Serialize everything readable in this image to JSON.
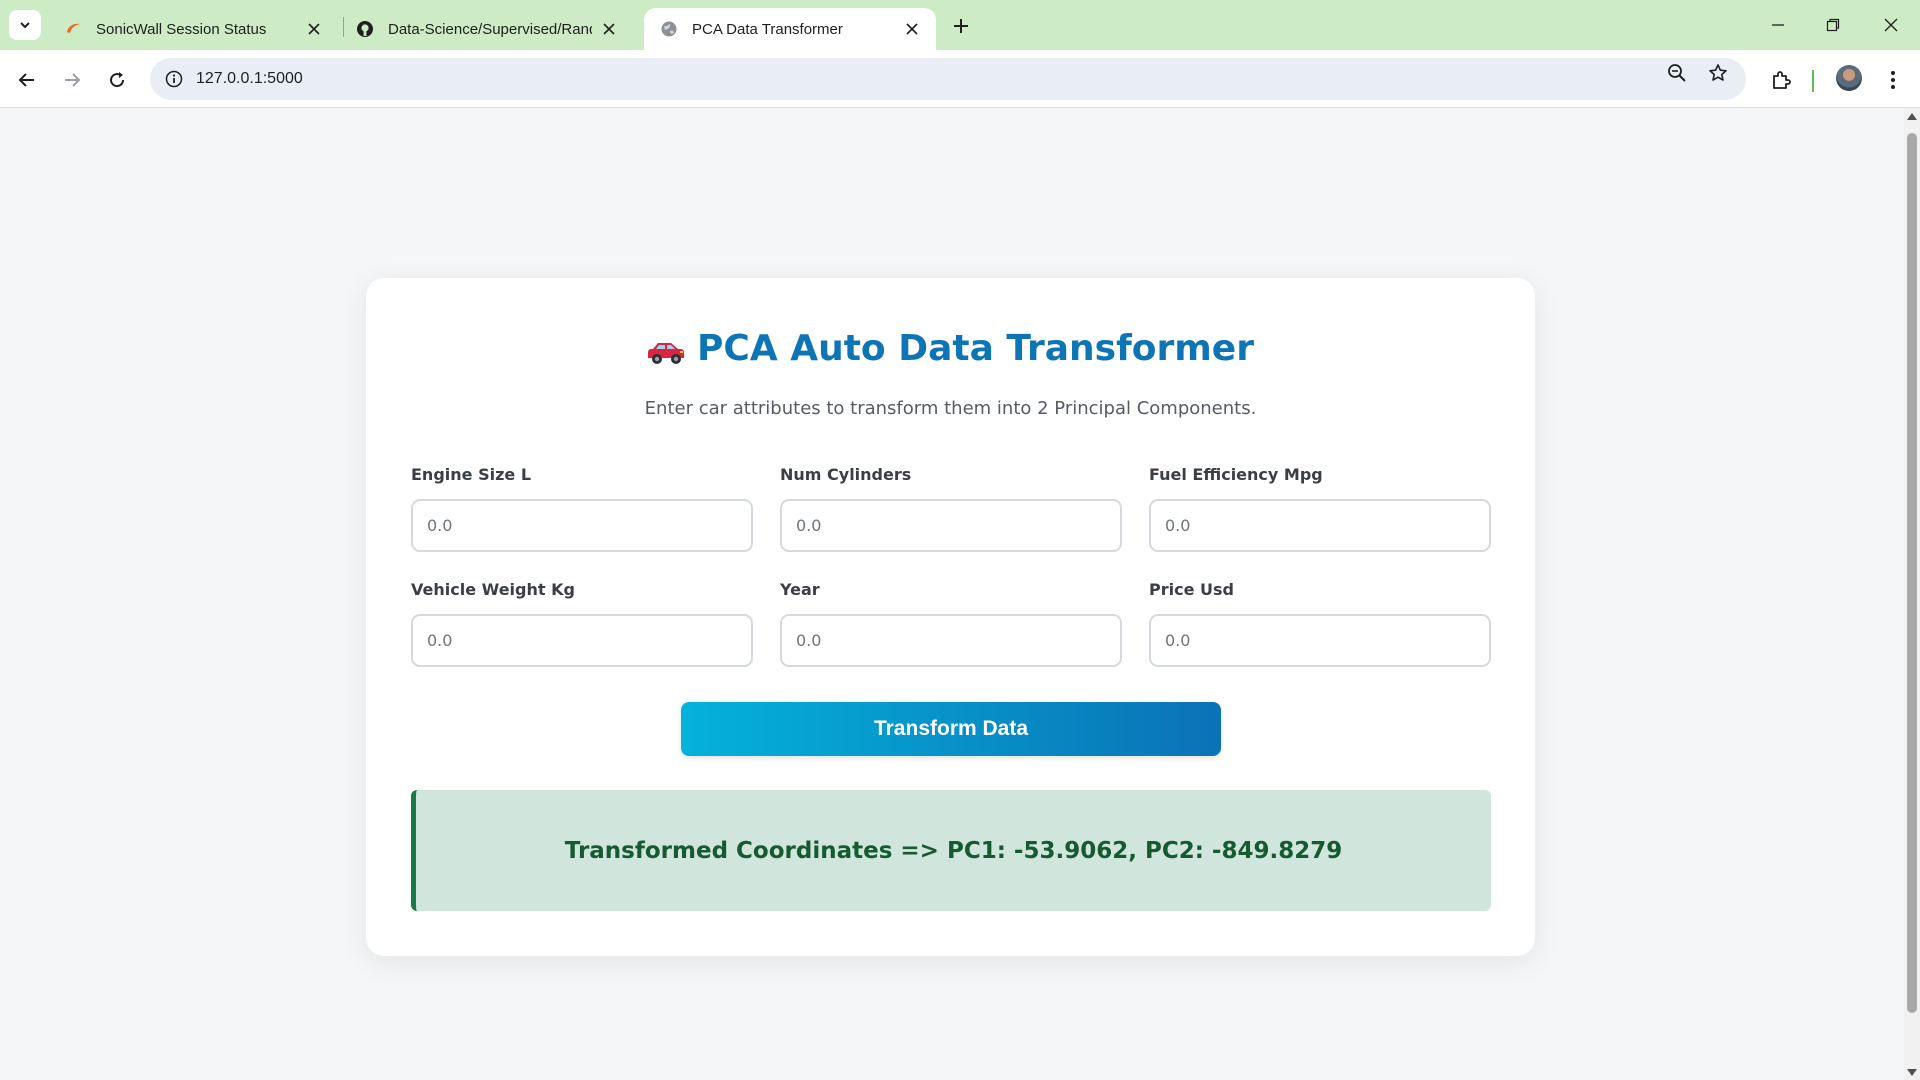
{
  "browser": {
    "tabs": [
      {
        "title": "SonicWall Session Status"
      },
      {
        "title": "Data-Science/Supervised/Random"
      },
      {
        "title": "PCA Data Transformer"
      }
    ],
    "url": "127.0.0.1:5000",
    "accent_color": "#cdebc5"
  },
  "page": {
    "title": "PCA Auto Data Transformer",
    "title_emoji": "car-icon",
    "subtitle": "Enter car attributes to transform them into 2 Principal Components.",
    "fields": [
      {
        "label": "Engine Size L",
        "placeholder": "0.0"
      },
      {
        "label": "Num Cylinders",
        "placeholder": "0.0"
      },
      {
        "label": "Fuel Efficiency Mpg",
        "placeholder": "0.0"
      },
      {
        "label": "Vehicle Weight Kg",
        "placeholder": "0.0"
      },
      {
        "label": "Year",
        "placeholder": "0.0"
      },
      {
        "label": "Price Usd",
        "placeholder": "0.0"
      }
    ],
    "button_label": "Transform Data",
    "result_text": "Transformed Coordinates => PC1: -53.9062, PC2: -849.8279",
    "colors": {
      "title": "#0d74b5",
      "button_start": "#04b2db",
      "button_end": "#0a72b6",
      "result_bg": "#d0e6dc",
      "result_text": "#165a32"
    }
  }
}
